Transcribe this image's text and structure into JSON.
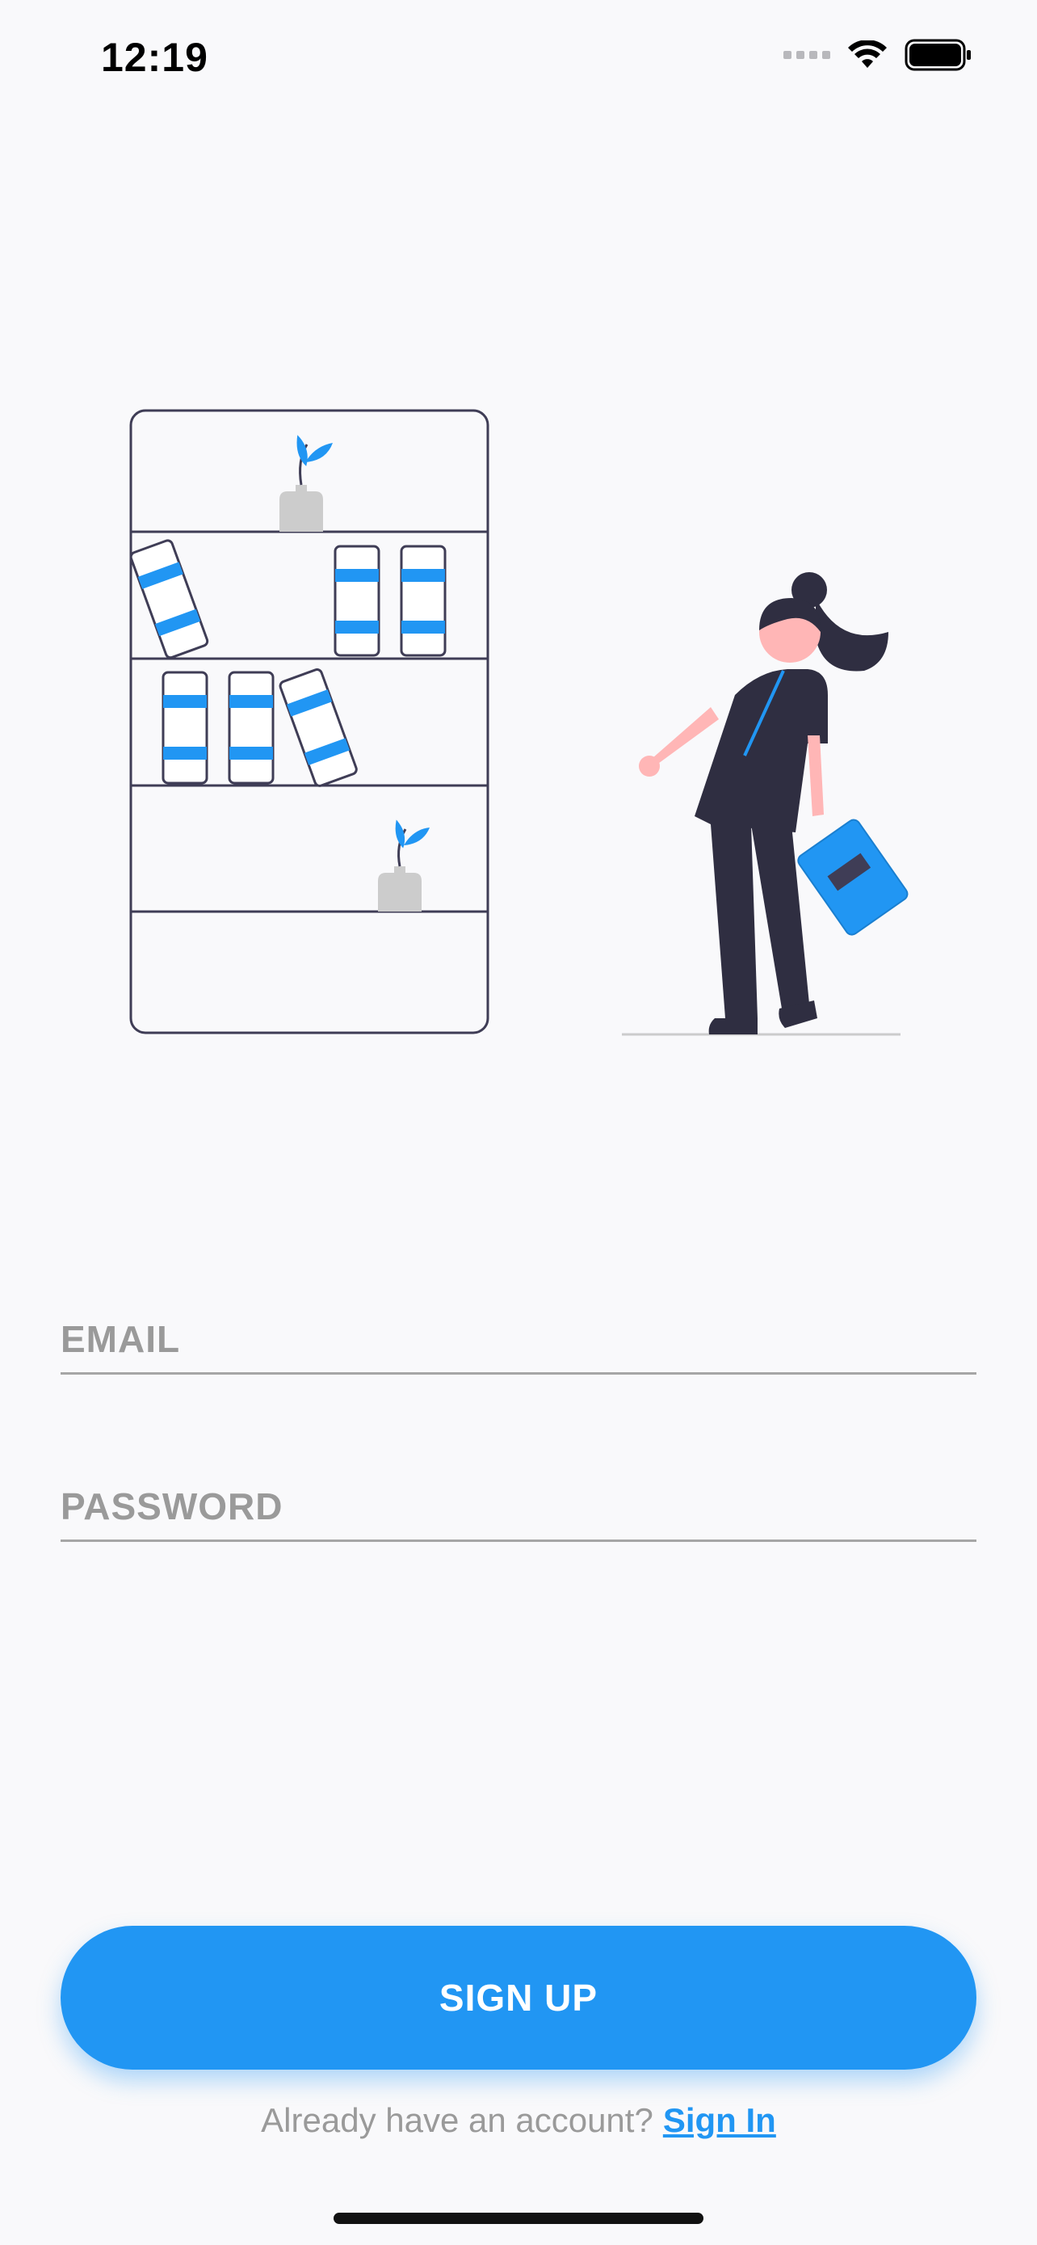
{
  "status_bar": {
    "time": "12:19",
    "icons": [
      "cellular-signal-icon",
      "wifi-icon",
      "battery-icon"
    ]
  },
  "illustration": {
    "description_icon": "bookshelf-woman-illustration",
    "colors": {
      "accent": "#2196f3",
      "outline": "#3f3d56",
      "skin": "#ffb6b6",
      "dark": "#2f2e41",
      "vase": "#cccccc"
    }
  },
  "form": {
    "email_placeholder": "EMAIL",
    "email_value": "",
    "password_placeholder": "PASSWORD",
    "password_value": ""
  },
  "actions": {
    "signup_label": "SIGN UP",
    "signin_prompt": "Already have an account?",
    "signin_link": "Sign In"
  },
  "colors": {
    "background": "#f9f9fb",
    "primary": "#2196f3",
    "placeholder": "#9a9a9a",
    "underline": "#a6a6a6"
  }
}
